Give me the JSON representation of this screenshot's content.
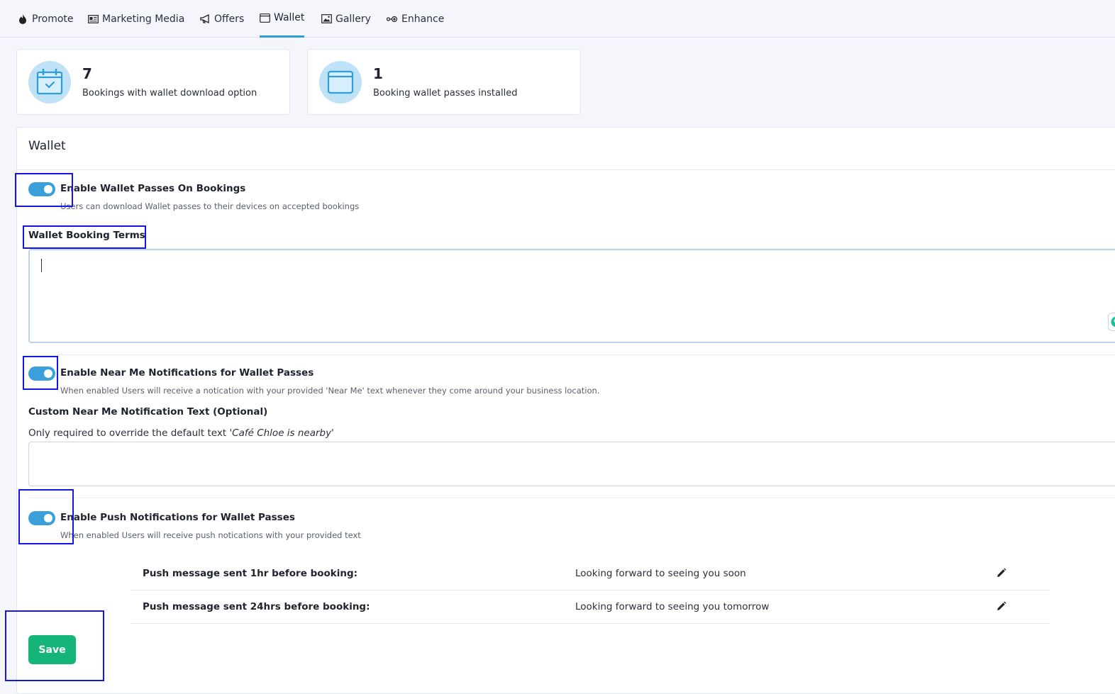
{
  "tabs": [
    {
      "label": "Promote",
      "icon": "flame-icon",
      "active": false
    },
    {
      "label": "Marketing Media",
      "icon": "media-icon",
      "active": false
    },
    {
      "label": "Offers",
      "icon": "megaphone-icon",
      "active": false
    },
    {
      "label": "Wallet",
      "icon": "wallet-icon",
      "active": true
    },
    {
      "label": "Gallery",
      "icon": "image-icon",
      "active": false
    },
    {
      "label": "Enhance",
      "icon": "enhance-icon",
      "active": false
    }
  ],
  "stats": [
    {
      "value": "7",
      "label": "Bookings with wallet download option",
      "icon": "calendar-check-icon"
    },
    {
      "value": "1",
      "label": "Booking wallet passes installed",
      "icon": "wallet-card-icon"
    }
  ],
  "wallet": {
    "title": "Wallet",
    "enable_passes": {
      "title": "Enable Wallet Passes On Bookings",
      "description": "Users can download Wallet passes to their devices on accepted bookings",
      "enabled": true
    },
    "terms": {
      "label": "Wallet Booking Terms",
      "value": ""
    },
    "near_me": {
      "title": "Enable Near Me Notifications for Wallet Passes",
      "description": "When enabled Users will receive a notication with your provided 'Near Me' text whenever they come around your business location.",
      "enabled": true
    },
    "custom_text": {
      "label": "Custom Near Me Notification Text (Optional)",
      "help_prefix": "Only required to override the default text",
      "help_default": "'Café Chloe is nearby'",
      "value": ""
    },
    "push": {
      "title": "Enable Push Notifications for Wallet Passes",
      "description": "When enabled Users will receive push notications with your provided text",
      "enabled": true,
      "messages": [
        {
          "key": "Push message sent 1hr before booking:",
          "value": "Looking forward to seeing you soon"
        },
        {
          "key": "Push message sent 24hrs before booking:",
          "value": "Looking forward to seeing you tomorrow"
        }
      ]
    },
    "save_label": "Save"
  },
  "colors": {
    "accent": "#3b9fdc",
    "save": "#15b57a",
    "annotation": "#1515e6"
  }
}
